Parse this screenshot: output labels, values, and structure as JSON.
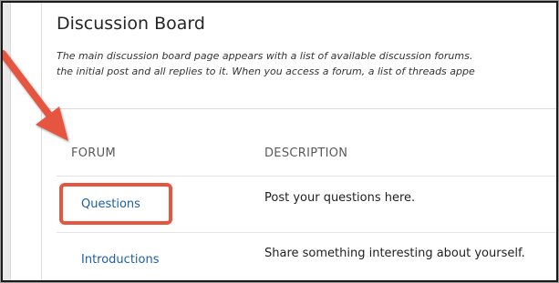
{
  "discussion_board": {
    "title": "Discussion Board",
    "intro_line_1": "The main discussion board page appears with a list of available discussion forums.",
    "intro_line_2": "the initial post and all replies to it. When you access a forum, a list of threads appe",
    "columns": {
      "forum": "FORUM",
      "description": "DESCRIPTION"
    },
    "forums": [
      {
        "name": "Questions",
        "description": "Post your questions here."
      },
      {
        "name": "Introductions",
        "description": "Share something interesting about yourself."
      }
    ]
  },
  "annotation": {
    "arrow_color": "#e5553f",
    "highlight_color": "#e5553f"
  },
  "colors": {
    "link": "#1a5fa8",
    "text": "#262626"
  }
}
